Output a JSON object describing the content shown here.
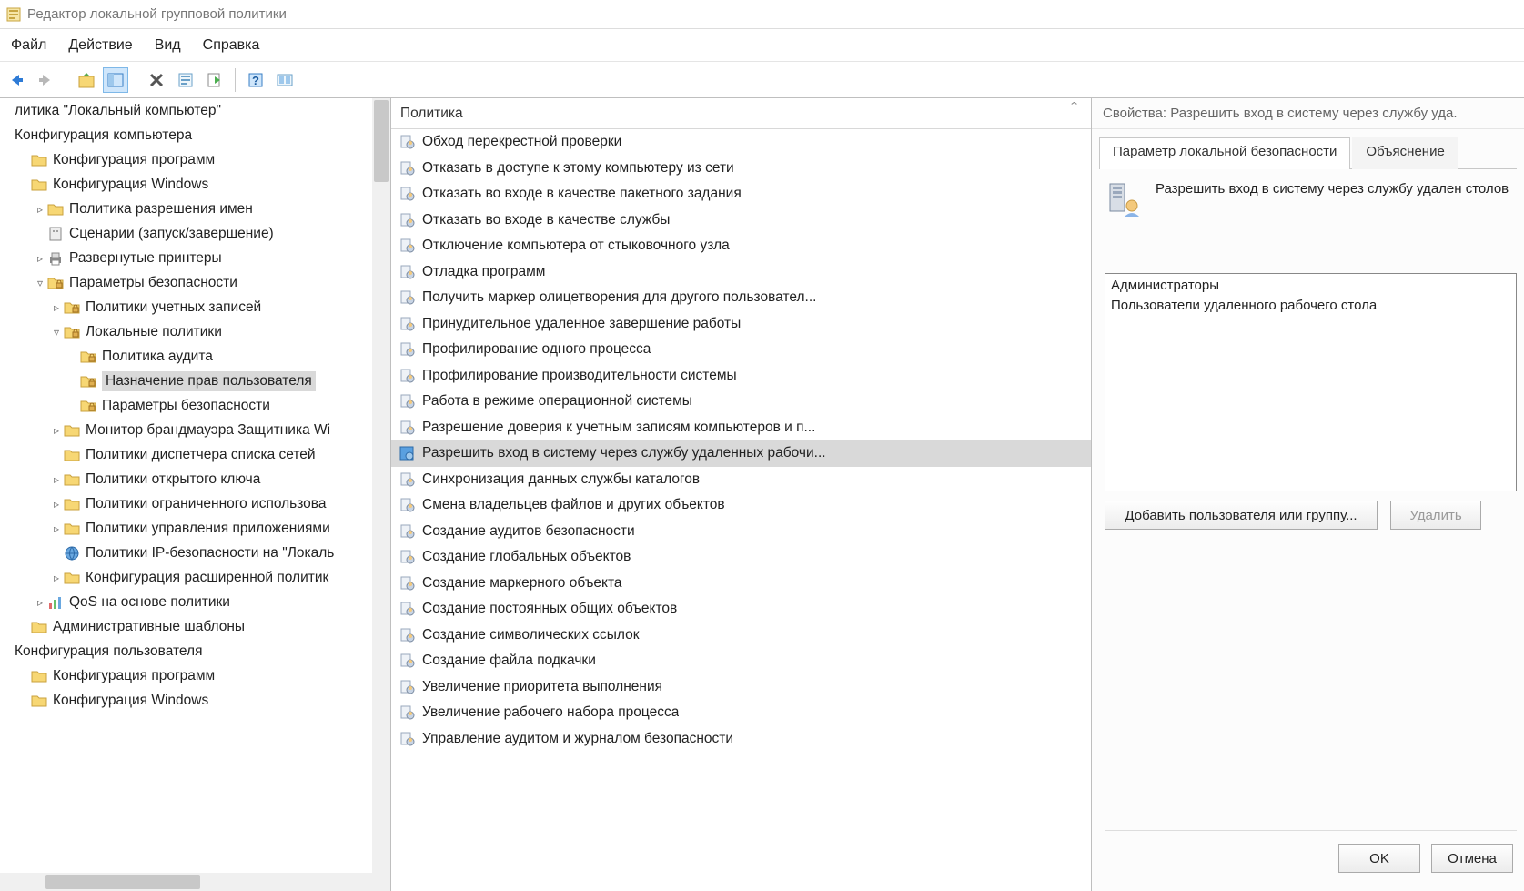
{
  "window": {
    "title": "Редактор локальной групповой политики"
  },
  "menubar": {
    "file": "Файл",
    "action": "Действие",
    "view": "Вид",
    "help": "Справка"
  },
  "tree": {
    "root": "литика \"Локальный компьютер\"",
    "computer_config": "Конфигурация компьютера",
    "programs_config": "Конфигурация программ",
    "windows_config": "Конфигурация Windows",
    "name_policy": "Политика разрешения имен",
    "scripts": "Сценарии (запуск/завершение)",
    "printers": "Развернутые принтеры",
    "security_params": "Параметры безопасности",
    "account_policies": "Политики учетных записей",
    "local_policies": "Локальные политики",
    "audit_policy": "Политика аудита",
    "user_rights": "Назначение прав пользователя",
    "security_options": "Параметры безопасности",
    "firewall_monitor": "Монитор брандмауэра Защитника Wi",
    "network_list": "Политики диспетчера списка сетей",
    "public_key": "Политики открытого ключа",
    "restricted": "Политики ограниченного использова",
    "app_control": "Политики управления приложениями",
    "ipsec": "Политики IP-безопасности на \"Локаль",
    "advanced_audit": "Конфигурация расширенной политик",
    "qos": "QoS на основе политики",
    "admin_templates": "Административные шаблоны",
    "user_config": "Конфигурация пользователя",
    "programs_config2": "Конфигурация программ",
    "windows_config2": "Конфигурация Windows"
  },
  "center": {
    "header": "Политика",
    "items": [
      "Обход перекрестной проверки",
      "Отказать в доступе к этому компьютеру из сети",
      "Отказать во входе в качестве пакетного задания",
      "Отказать во входе в качестве службы",
      "Отключение компьютера от стыковочного узла",
      "Отладка программ",
      "Получить маркер олицетворения для другого пользовател...",
      "Принудительное удаленное завершение работы",
      "Профилирование одного процесса",
      "Профилирование производительности системы",
      "Работа в режиме операционной системы",
      "Разрешение доверия к учетным записям компьютеров и п...",
      "Разрешить вход в систему через службу удаленных рабочи...",
      "Синхронизация данных службы каталогов",
      "Смена владельцев файлов и других объектов",
      "Создание аудитов безопасности",
      "Создание глобальных объектов",
      "Создание маркерного объекта",
      "Создание постоянных общих объектов",
      "Создание символических ссылок",
      "Создание файла подкачки",
      "Увеличение приоритета выполнения",
      "Увеличение рабочего набора процесса",
      "Управление аудитом и журналом безопасности"
    ],
    "selected_index": 12
  },
  "properties": {
    "title": "Свойства: Разрешить вход в систему через службу уда.",
    "tab_local": "Параметр локальной безопасности",
    "tab_explain": "Объяснение",
    "description": "Разрешить вход в систему через службу удален столов",
    "users": [
      "Администраторы",
      "Пользователи удаленного рабочего стола"
    ],
    "add_btn": "Добавить пользователя или группу...",
    "delete_btn": "Удалить",
    "ok_btn": "OK",
    "cancel_btn": "Отмена"
  }
}
